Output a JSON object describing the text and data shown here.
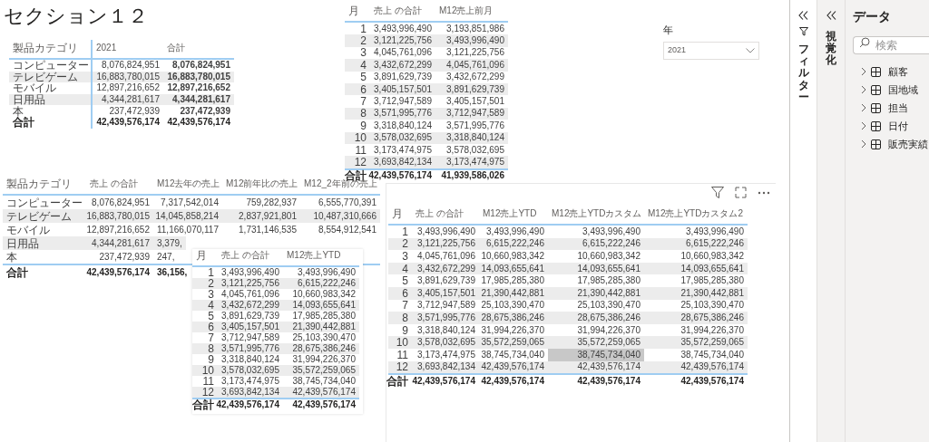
{
  "title": "セクション１２",
  "matrix": {
    "columns": [
      "製品カテゴリ",
      "2021",
      "合計"
    ],
    "rows": [
      [
        "コンピューター",
        "8,076,824,951",
        "8,076,824,951"
      ],
      [
        "テレビゲーム",
        "16,883,780,015",
        "16,883,780,015"
      ],
      [
        "モバイル",
        "12,897,216,652",
        "12,897,216,652"
      ],
      [
        "日用品",
        "4,344,281,617",
        "4,344,281,617"
      ],
      [
        "本",
        "237,472,939",
        "237,472,939"
      ]
    ],
    "total": [
      "合計",
      "42,439,576,174",
      "42,439,576,174"
    ]
  },
  "month_table": {
    "columns": [
      "月",
      "売上 の合計",
      "M12売上前月"
    ],
    "rows": [
      [
        "1",
        "3,493,996,490",
        "3,193,851,986"
      ],
      [
        "2",
        "3,121,225,756",
        "3,493,996,490"
      ],
      [
        "3",
        "4,045,761,096",
        "3,121,225,756"
      ],
      [
        "4",
        "3,432,672,299",
        "4,045,761,096"
      ],
      [
        "5",
        "3,891,629,739",
        "3,432,672,299"
      ],
      [
        "6",
        "3,405,157,501",
        "3,891,629,739"
      ],
      [
        "7",
        "3,712,947,589",
        "3,405,157,501"
      ],
      [
        "8",
        "3,571,995,776",
        "3,712,947,589"
      ],
      [
        "9",
        "3,318,840,124",
        "3,571,995,776"
      ],
      [
        "10",
        "3,578,032,695",
        "3,318,840,124"
      ],
      [
        "11",
        "3,173,474,975",
        "3,578,032,695"
      ],
      [
        "12",
        "3,693,842,134",
        "3,173,474,975"
      ]
    ],
    "total": [
      "合計",
      "42,439,576,174",
      "41,939,586,026"
    ]
  },
  "slicer": {
    "label": "年",
    "value": "2021"
  },
  "category_table": {
    "columns": [
      "製品カテゴリ",
      "売上 の合計",
      "M12去年の売上",
      "M12前年比の売上",
      "M12_2年前の売上"
    ],
    "rows": [
      [
        "コンピューター",
        "8,076,824,951",
        "7,317,542,014",
        "759,282,937",
        "6,555,770,391"
      ],
      [
        "テレビゲーム",
        "16,883,780,015",
        "14,045,858,214",
        "2,837,921,801",
        "10,487,310,666"
      ],
      [
        "モバイル",
        "12,897,216,652",
        "11,166,070,117",
        "1,731,146,535",
        "8,554,912,541"
      ],
      [
        "日用品",
        "4,344,281,617",
        "3,379,"
      ],
      [
        "本",
        "237,472,939",
        "247,"
      ]
    ],
    "total": [
      "合計",
      "42,439,576,174",
      "36,156,"
    ]
  },
  "ytd_table": {
    "columns": [
      "月",
      "売上 の合計",
      "M12売上YTD"
    ],
    "rows": [
      [
        "1",
        "3,493,996,490",
        "3,493,996,490"
      ],
      [
        "2",
        "3,121,225,756",
        "6,615,222,246"
      ],
      [
        "3",
        "4,045,761,096",
        "10,660,983,342"
      ],
      [
        "4",
        "3,432,672,299",
        "14,093,655,641"
      ],
      [
        "5",
        "3,891,629,739",
        "17,985,285,380"
      ],
      [
        "6",
        "3,405,157,501",
        "21,390,442,881"
      ],
      [
        "7",
        "3,712,947,589",
        "25,103,390,470"
      ],
      [
        "8",
        "3,571,995,776",
        "28,675,386,246"
      ],
      [
        "9",
        "3,318,840,124",
        "31,994,226,370"
      ],
      [
        "10",
        "3,578,032,695",
        "35,572,259,065"
      ],
      [
        "11",
        "3,173,474,975",
        "38,745,734,040"
      ],
      [
        "12",
        "3,693,842,134",
        "42,439,576,174"
      ]
    ],
    "total": [
      "合計",
      "42,439,576,174",
      "42,439,576,174"
    ]
  },
  "ytd_custom_table": {
    "columns": [
      "月",
      "売上 の合計",
      "M12売上YTD",
      "M12売上YTDカスタム",
      "M12売上YTDカスタム2"
    ],
    "rows": [
      {
        "cells": [
          "1",
          "3,493,996,490",
          "3,493,996,490",
          "3,493,996,490",
          "3,493,996,490"
        ],
        "hovered": [
          false,
          false,
          false,
          false,
          false
        ]
      },
      {
        "cells": [
          "2",
          "3,121,225,756",
          "6,615,222,246",
          "6,615,222,246",
          "6,615,222,246"
        ],
        "hovered": [
          false,
          false,
          false,
          false,
          false
        ]
      },
      {
        "cells": [
          "3",
          "4,045,761,096",
          "10,660,983,342",
          "10,660,983,342",
          "10,660,983,342"
        ],
        "hovered": [
          false,
          false,
          false,
          false,
          false
        ]
      },
      {
        "cells": [
          "4",
          "3,432,672,299",
          "14,093,655,641",
          "14,093,655,641",
          "14,093,655,641"
        ],
        "hovered": [
          false,
          false,
          false,
          false,
          false
        ]
      },
      {
        "cells": [
          "5",
          "3,891,629,739",
          "17,985,285,380",
          "17,985,285,380",
          "17,985,285,380"
        ],
        "hovered": [
          false,
          false,
          false,
          false,
          false
        ]
      },
      {
        "cells": [
          "6",
          "3,405,157,501",
          "21,390,442,881",
          "21,390,442,881",
          "21,390,442,881"
        ],
        "hovered": [
          false,
          false,
          false,
          false,
          false
        ]
      },
      {
        "cells": [
          "7",
          "3,712,947,589",
          "25,103,390,470",
          "25,103,390,470",
          "25,103,390,470"
        ],
        "hovered": [
          false,
          false,
          false,
          false,
          false
        ]
      },
      {
        "cells": [
          "8",
          "3,571,995,776",
          "28,675,386,246",
          "28,675,386,246",
          "28,675,386,246"
        ],
        "hovered": [
          false,
          false,
          false,
          false,
          false
        ]
      },
      {
        "cells": [
          "9",
          "3,318,840,124",
          "31,994,226,370",
          "31,994,226,370",
          "31,994,226,370"
        ],
        "hovered": [
          false,
          false,
          false,
          false,
          false
        ]
      },
      {
        "cells": [
          "10",
          "3,578,032,695",
          "35,572,259,065",
          "35,572,259,065",
          "35,572,259,065"
        ],
        "hovered": [
          false,
          false,
          false,
          false,
          false
        ]
      },
      {
        "cells": [
          "11",
          "3,173,474,975",
          "38,745,734,040",
          "38,745,734,040",
          "38,745,734,040"
        ],
        "hovered": [
          false,
          false,
          false,
          true,
          false
        ]
      },
      {
        "cells": [
          "12",
          "3,693,842,134",
          "42,439,576,174",
          "42,439,576,174",
          "42,439,576,174"
        ],
        "hovered": [
          false,
          false,
          false,
          false,
          false
        ]
      }
    ],
    "total": [
      "合計",
      "42,439,576,174",
      "42,439,576,174",
      "42,439,576,174",
      "42,439,576,174"
    ]
  },
  "filters_pane": {
    "label": "フィルター"
  },
  "visualizations_pane": {
    "label": "視覚化"
  },
  "data_pane": {
    "title": "データ",
    "search_placeholder": "検索",
    "tables": [
      {
        "name": "顧客",
        "expanded": false
      },
      {
        "name": "国地域",
        "expanded": false
      },
      {
        "name": "担当",
        "expanded": false
      },
      {
        "name": "日付",
        "expanded": false
      },
      {
        "name": "販売実績",
        "expanded": false
      }
    ]
  }
}
